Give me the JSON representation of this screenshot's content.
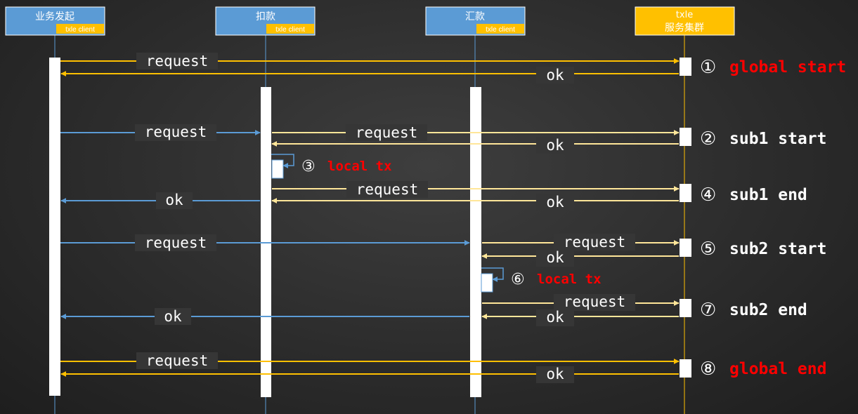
{
  "participants": [
    {
      "title": "业务发起",
      "tag": "txle client"
    },
    {
      "title": "扣款",
      "tag": "txle client"
    },
    {
      "title": "汇款",
      "tag": "txle client"
    },
    {
      "title_line1": "txle",
      "title_line2": "服务集群"
    }
  ],
  "labels": {
    "request": "request",
    "ok": "ok"
  },
  "steps": [
    {
      "num": "①",
      "label": "global start"
    },
    {
      "num": "②",
      "label": "sub1 start"
    },
    {
      "num": "③",
      "label": "local tx"
    },
    {
      "num": "④",
      "label": "sub1 end"
    },
    {
      "num": "⑤",
      "label": "sub2 start"
    },
    {
      "num": "⑥",
      "label": "local tx"
    },
    {
      "num": "⑦",
      "label": "sub2 end"
    },
    {
      "num": "⑧",
      "label": "global end"
    }
  ],
  "colors": {
    "blue": "#5b9bd5",
    "orange": "#ffc000",
    "light_orange": "#ffe699",
    "red": "#ff0000",
    "white": "#ffffff"
  }
}
